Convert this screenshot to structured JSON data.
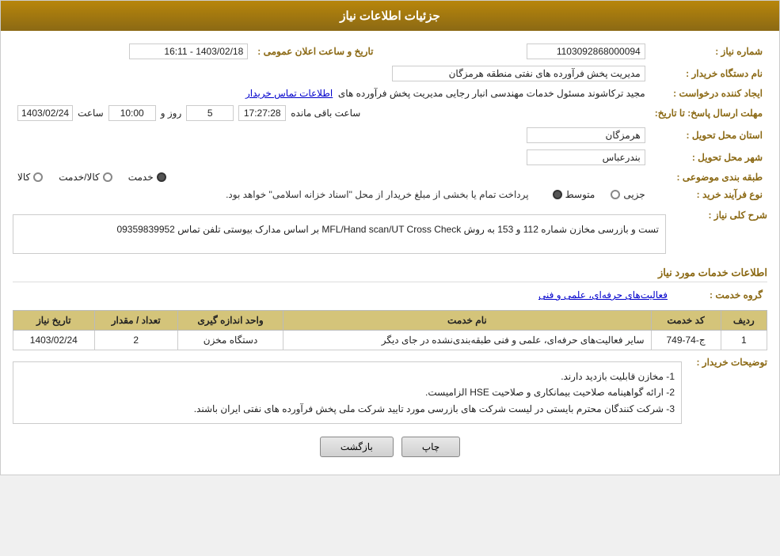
{
  "header": {
    "title": "جزئیات اطلاعات نیاز"
  },
  "fields": {
    "shomareNiaz_label": "شماره نیاز :",
    "shomareNiaz_value": "1103092868000094",
    "namDastgah_label": "نام دستگاه خریدار :",
    "namDastgah_value": "مدیریت پخش فرآورده های نفتی منطقه هرمزگان",
    "tarikhAelan_label": "تاریخ و ساعت اعلان عمومی :",
    "tarikhAelan_value": "1403/02/18 - 16:11",
    "ijadKonande_label": "ایجاد کننده درخواست :",
    "ijadKonande_value": "مجید ترکاشوند مسئول خدمات مهندسی انبار رجایی مدیریت پخش فرآورده های",
    "ijadKonande_link": "اطلاعات تماس خریدار",
    "mohlatErsalJavab_label": "مهلت ارسال پاسخ: تا تاریخ:",
    "tarikhPasokh_value": "1403/02/24",
    "saatPasokh_label": "ساعت",
    "saatPasokh_value": "10:00",
    "roz_label": "روز و",
    "roz_value": "5",
    "saat_label": "ساعت باقی مانده",
    "saat_value": "17:27:28",
    "ostan_label": "استان محل تحویل :",
    "ostan_value": "هرمزگان",
    "shahr_label": "شهر محل تحویل :",
    "shahr_value": "بندرعباس",
    "tabaqeBandi_label": "طبقه بندی موضوعی :",
    "tabaqeBandi_options": [
      "خدمت",
      "کالا/خدمت",
      "کالا"
    ],
    "tabaqeBandi_selected": "کالا",
    "noeFarayandKharid_label": "نوع فرآیند خرید :",
    "noeFarayandKharid_options": [
      "جزیی",
      "متوسط",
      ""
    ],
    "noeFarayandKharid_selected": "متوسط",
    "noeFarayandKharid_note": "پرداخت تمام یا بخشی از مبلغ خریدار از محل \"اسناد خزانه اسلامی\" خواهد بود.",
    "sharhKolliNiaz_label": "شرح کلی نیاز :",
    "sharhKolliNiaz_value": "تست و بازرسی مخازن شماره 112 و 153 به روش MFL/Hand scan/UT Cross Check بر اساس مدارک بیوستی تلفن تماس 09359839952",
    "etelaatKhadamat_title": "اطلاعات خدمات مورد نیاز",
    "grohKhadamat_label": "گروه خدمت :",
    "grohKhadamat_value": "فعالیت‌های حرفه‌ای، علمی و فنی",
    "table": {
      "headers": [
        "ردیف",
        "کد خدمت",
        "نام خدمت",
        "واحد اندازه گیری",
        "تعداد / مقدار",
        "تاریخ نیاز"
      ],
      "rows": [
        {
          "radif": "1",
          "kodKhadamat": "ج-74-749",
          "namKhadamat": "سایر فعالیت‌های حرفه‌ای، علمی و فنی طبقه‌بندی‌نشده در جای دیگر",
          "vahed": "دستگاه مخزن",
          "tedad": "2",
          "tarikh": "1403/02/24"
        }
      ]
    },
    "tozihat_label": "توضیحات خریدار :",
    "tozihat_value": "1- مخازن قابلیت بازدید دارند.\n2- ارائه گواهینامه صلاحیت بیمانکاری و صلاحیت HSE الزامیست.\n3- شرکت کنندگان محترم بایستی در لیست شرکت های بازرسی مورد تایید شرکت ملی پخش فرآورده های نفتی ایران باشند.",
    "buttons": {
      "chap": "چاپ",
      "bazgasht": "بازگشت"
    }
  }
}
